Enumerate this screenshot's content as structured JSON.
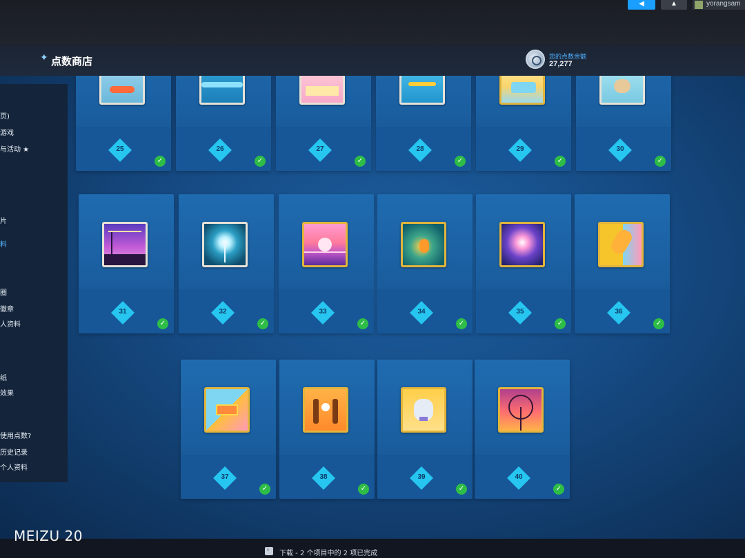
{
  "topbar": {
    "username": "yorangsam"
  },
  "header": {
    "title": "点数商店",
    "balance_label": "您的点数余额",
    "balance_value": "27,277"
  },
  "sidebar": {
    "items": [
      {
        "label": "页)",
        "active": false
      },
      {
        "label": "游戏",
        "active": false
      },
      {
        "label": "与活动 ★",
        "active": false
      },
      {
        "label": "片",
        "active": false
      },
      {
        "label": "料",
        "active": true
      },
      {
        "label": "圈",
        "active": false
      },
      {
        "label": "徽章",
        "active": false
      },
      {
        "label": "人资料",
        "active": false
      },
      {
        "label": "纸",
        "active": false
      },
      {
        "label": "效果",
        "active": false
      },
      {
        "label": "使用点数?",
        "active": false
      },
      {
        "label": "历史记录",
        "active": false
      },
      {
        "label": "个人资料",
        "active": false
      }
    ]
  },
  "cards": [
    {
      "level": "25",
      "owned": true
    },
    {
      "level": "26",
      "owned": true
    },
    {
      "level": "27",
      "owned": true
    },
    {
      "level": "28",
      "owned": true
    },
    {
      "level": "29",
      "owned": true
    },
    {
      "level": "30",
      "owned": true
    },
    {
      "level": "31",
      "owned": true
    },
    {
      "level": "32",
      "owned": true
    },
    {
      "level": "33",
      "owned": true
    },
    {
      "level": "34",
      "owned": true
    },
    {
      "level": "35",
      "owned": true
    },
    {
      "level": "36",
      "owned": true
    },
    {
      "level": "37",
      "owned": true
    },
    {
      "level": "38",
      "owned": true
    },
    {
      "level": "39",
      "owned": true
    },
    {
      "level": "40",
      "owned": true
    }
  ],
  "footer": {
    "download_status": "下载 - 2 个项目中的 2 项已完成"
  },
  "watermark": "MEIZU 20",
  "colors": {
    "accent": "#1a9fff",
    "level_diamond": "#26c6f0",
    "owned_check": "#2ebd46"
  }
}
